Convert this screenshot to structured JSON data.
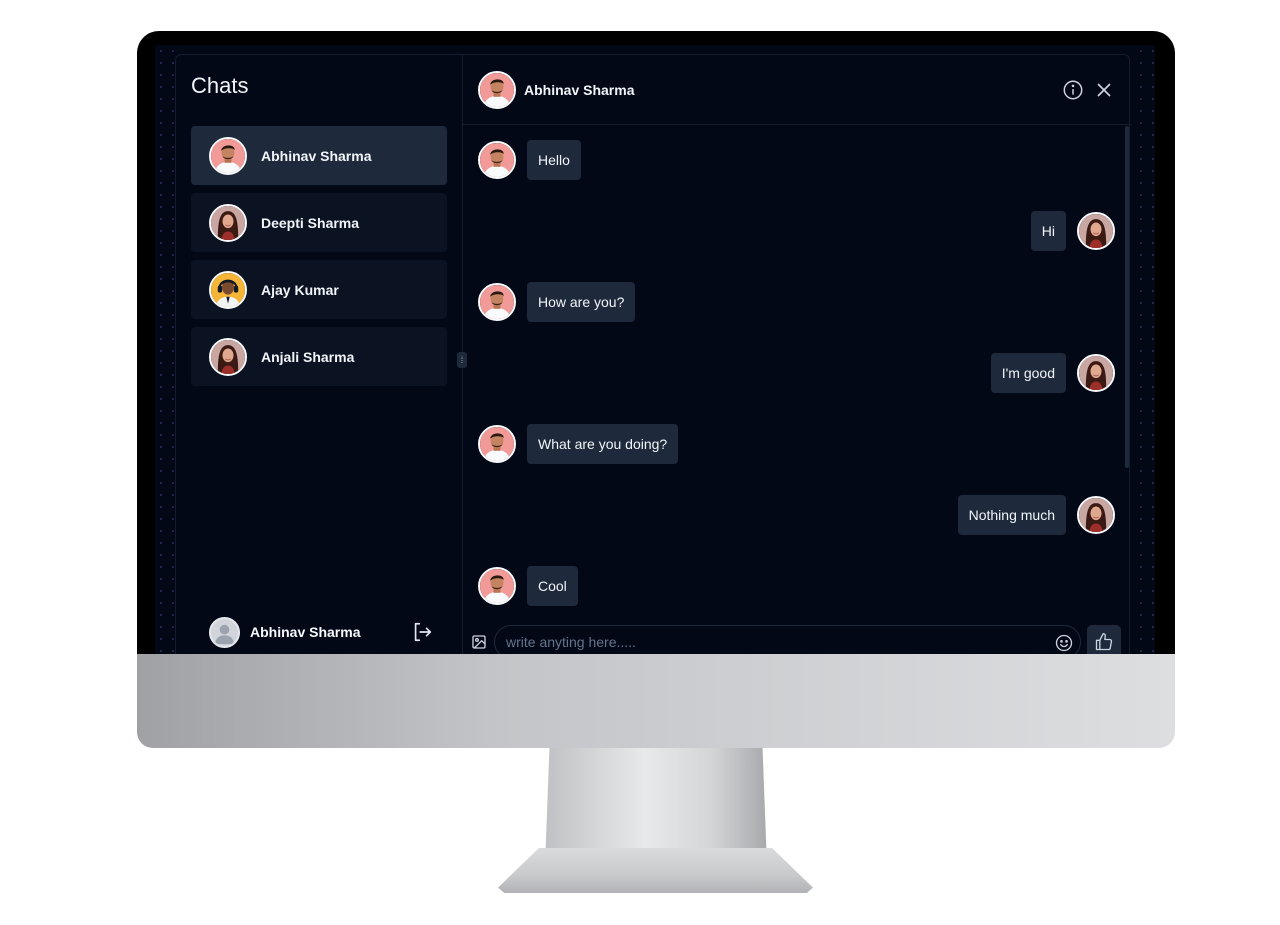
{
  "sidebar": {
    "title": "Chats",
    "contacts": [
      {
        "name": "Abhinav Sharma",
        "avatar": "man-avatar",
        "active": true
      },
      {
        "name": "Deepti Sharma",
        "avatar": "woman-avatar",
        "active": false
      },
      {
        "name": "Ajay Kumar",
        "avatar": "man-headphones-avatar",
        "active": false
      },
      {
        "name": "Anjali Sharma",
        "avatar": "woman-avatar",
        "active": false
      }
    ],
    "current_user": {
      "name": "Abhinav Sharma",
      "avatar": "default-user-icon"
    },
    "logout_icon": "logout-icon"
  },
  "chat": {
    "header": {
      "name": "Abhinav Sharma",
      "info_icon": "info-icon",
      "close_icon": "close-icon"
    },
    "messages": [
      {
        "direction": "incoming",
        "text": "Hello"
      },
      {
        "direction": "outgoing",
        "text": "Hi"
      },
      {
        "direction": "incoming",
        "text": "How are you?"
      },
      {
        "direction": "outgoing",
        "text": "I'm good"
      },
      {
        "direction": "incoming",
        "text": "What are you doing?"
      },
      {
        "direction": "outgoing",
        "text": "Nothing much"
      },
      {
        "direction": "incoming",
        "text": "Cool"
      }
    ],
    "composer": {
      "placeholder": "write anyting here.....",
      "value": "",
      "image_icon": "image-icon",
      "emoji_icon": "smiley-icon",
      "send_icon": "thumbs-up-icon"
    }
  },
  "colors": {
    "background": "#030817",
    "bubble": "#1e293b",
    "text": "#f1f5f9",
    "muted": "#64748b"
  }
}
